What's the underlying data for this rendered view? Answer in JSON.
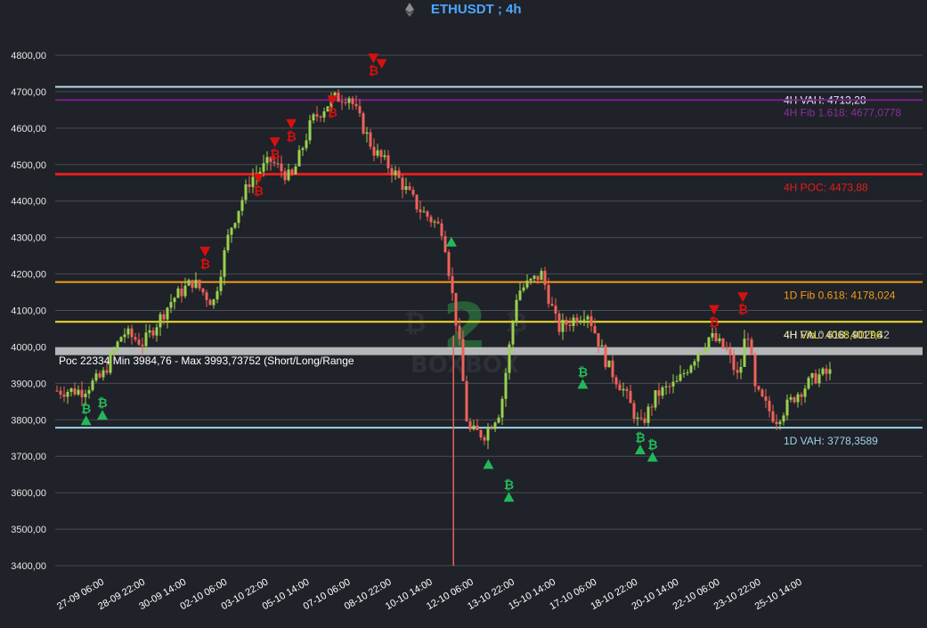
{
  "header": {
    "icon": "ethereum-icon",
    "title": "ETHUSDT ; 4h",
    "title_color": "#4da6ff"
  },
  "watermark": {
    "big": "2",
    "left_symbol": "₿",
    "right_symbol": "₿",
    "text": "BOXBOX"
  },
  "chart_data": {
    "type": "candlestick",
    "ylim": [
      3400,
      4800
    ],
    "y_ticks": [
      "3400,00",
      "3500,00",
      "3600,00",
      "3700,00",
      "3800,00",
      "3900,00",
      "4000,00",
      "4100,00",
      "4200,00",
      "4300,00",
      "4400,00",
      "4500,00",
      "4600,00",
      "4700,00",
      "4800,00"
    ],
    "x_ticks": [
      "27-09 06:00",
      "28-09 22:00",
      "30-09 14:00",
      "02-10 06:00",
      "03-10 22:00",
      "05-10 14:00",
      "07-10 06:00",
      "08-10 22:00",
      "10-10 14:00",
      "12-10 06:00",
      "13-10 22:00",
      "15-10 14:00",
      "17-10 06:00",
      "18-10 22:00",
      "20-10 14:00",
      "22-10 06:00",
      "23-10 22:00",
      "25-10 14:00"
    ],
    "colors": {
      "up": "#9bd14f",
      "down": "#f0625a",
      "grid": "#4a4d55",
      "buy_signal": "#22b85a",
      "sell_signal": "#d41010"
    },
    "price_path": [
      [
        0,
        3880
      ],
      [
        0.5,
        3920
      ],
      [
        1,
        4040
      ],
      [
        1.5,
        4010
      ],
      [
        2.2,
        4130
      ],
      [
        2.7,
        4180
      ],
      [
        3.2,
        4120
      ],
      [
        3.6,
        4320
      ],
      [
        4.1,
        4460
      ],
      [
        4.6,
        4510
      ],
      [
        5.1,
        4460
      ],
      [
        5.6,
        4620
      ],
      [
        6.1,
        4680
      ],
      [
        6.5,
        4690
      ],
      [
        7.1,
        4540
      ],
      [
        7.6,
        4480
      ],
      [
        8.2,
        4380
      ],
      [
        8.8,
        4320
      ],
      [
        9.2,
        4000
      ],
      [
        9.4,
        3770
      ],
      [
        9.8,
        3760
      ],
      [
        10.2,
        3830
      ],
      [
        10.6,
        4150
      ],
      [
        11.2,
        4200
      ],
      [
        11.6,
        4050
      ],
      [
        12.3,
        4100
      ],
      [
        12.8,
        3950
      ],
      [
        13.2,
        3880
      ],
      [
        13.6,
        3780
      ],
      [
        14.0,
        3870
      ],
      [
        14.5,
        3900
      ],
      [
        14.9,
        3970
      ],
      [
        15.3,
        4030
      ],
      [
        15.7,
        3990
      ],
      [
        16.0,
        3910
      ],
      [
        16.2,
        4060
      ],
      [
        16.4,
        3880
      ],
      [
        16.9,
        3800
      ],
      [
        17.4,
        3870
      ],
      [
        17.9,
        3920
      ],
      [
        18.3,
        3930
      ]
    ],
    "levels": [
      {
        "label": "4H VAH: 4713,28",
        "price": 4713.28,
        "color": "#b6d8e6",
        "label_color": "#e8e8ff"
      },
      {
        "label": "4H Fib 1.618: 4677,0778",
        "price": 4677.0778,
        "color": "#7a1f8a",
        "label_color": "#8a2f9a"
      },
      {
        "label": "4H POC: 4473,88",
        "price": 4473.88,
        "color": "#e01e1e",
        "label_color": "#e01e1e"
      },
      {
        "label": "1D Fib 0.618: 4178,024",
        "price": 4178.024,
        "color": "#f39c1a",
        "label_color": "#f39c1a"
      },
      {
        "label": "4H VAL: 4068,90296",
        "price": 4068.90296,
        "color": "#f0e030",
        "label_color": "#f0e030"
      },
      {
        "label": "1D VAH: 3778,3589",
        "price": 3778.3589,
        "color": "#9fd3ea",
        "label_color": "#9fd3ea"
      }
    ],
    "overlap_label": {
      "text": "4H Fib 0.618: 4017,42",
      "color": "#e6e6e6"
    },
    "range_band": {
      "min": 3984.76,
      "max": 3993.73752,
      "color": "#d0d0d0"
    },
    "annotation": "Poc 22334  Min 3984,76 - Max 3993,73752  (Short/Long/Range",
    "signals": [
      {
        "type": "buy",
        "x": 0.1,
        "price": 3800,
        "text": "₿"
      },
      {
        "type": "buy",
        "x": 0.5,
        "price": 3815,
        "text": "₿"
      },
      {
        "type": "sell",
        "x": 3.0,
        "price": 4260,
        "text": "₿"
      },
      {
        "type": "sell",
        "x": 4.3,
        "price": 4460,
        "text": "₿"
      },
      {
        "type": "sell",
        "x": 4.7,
        "price": 4560,
        "text": "₿"
      },
      {
        "type": "sell",
        "x": 5.1,
        "price": 4610,
        "text": "₿"
      },
      {
        "type": "sell",
        "x": 6.1,
        "price": 4675,
        "text": "₿"
      },
      {
        "type": "sell",
        "x": 7.1,
        "price": 4790,
        "text": "₿"
      },
      {
        "type": "sell",
        "x": 7.3,
        "price": 4775,
        "text": ""
      },
      {
        "type": "buy",
        "x": 9.0,
        "price": 4290,
        "text": ""
      },
      {
        "type": "buy",
        "x": 9.9,
        "price": 3680,
        "text": ""
      },
      {
        "type": "buy",
        "x": 10.4,
        "price": 3590,
        "text": "₿"
      },
      {
        "type": "buy",
        "x": 12.2,
        "price": 3900,
        "text": "₿"
      },
      {
        "type": "buy",
        "x": 13.6,
        "price": 3720,
        "text": "₿"
      },
      {
        "type": "buy",
        "x": 13.9,
        "price": 3700,
        "text": "₿"
      },
      {
        "type": "sell",
        "x": 15.4,
        "price": 4100,
        "text": "₿"
      },
      {
        "type": "sell",
        "x": 16.1,
        "price": 4135,
        "text": "₿"
      }
    ]
  }
}
